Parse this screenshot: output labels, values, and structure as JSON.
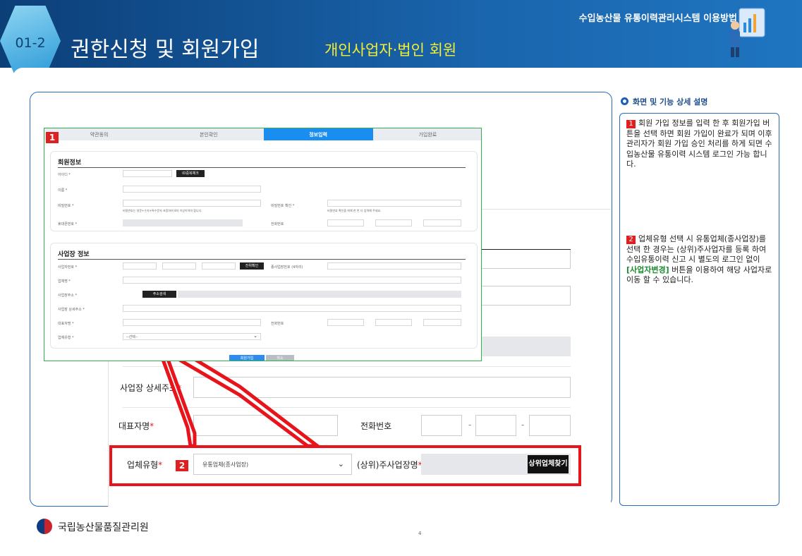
{
  "header": {
    "system_title": "수입농산물 유통이력관리시스템 이용방법",
    "section_no": "01-2",
    "title": "권한신청 및 회원가입",
    "subtitle": "개인사업자·법인 회원"
  },
  "panel": {
    "heading": "화면 및 기능 상세 설명",
    "notes": [
      {
        "num": "1",
        "text": "회원 가입 정보를 입력 한 후 회원가입 버튼을 선택 하면 회원 가입이 완료가 되며 이후 관리자가 회원 가입 승인 처리를 하게 되면 수입농산물 유통이력 시스템 로그인 가능 합니다."
      },
      {
        "num": "2",
        "text_before": "업체유형 선택 시 유통업체(종사업장)를 선택 한 경우는 (상위)주사업자를 등록 하여 수입유통이력 신고 시 별도의 로그인 없이 ",
        "highlight": "[사업자변경]",
        "text_after": " 버튼을 이용하여 해당 사업자로 이동 할 수 있습니다."
      }
    ]
  },
  "screenshot1": {
    "tag": "1",
    "steps": [
      "약관동의",
      "본인확인",
      "정보입력",
      "가입완료"
    ],
    "member_section": "회원정보",
    "member_fields": [
      "아이디 *",
      "이름 *",
      "비밀번호 *",
      "휴대폰번호 *"
    ],
    "id_check_btn": "ID중복체크",
    "pw_hint": "비밀번호는 영문+숫자+특수문자 포함하여 8자 이상이어야 합니다.",
    "pw_confirm_label": "비밀번호 확인 *",
    "pw_confirm_hint": "비밀번호 확인을 위해 한 번 더 입력해 주세요.",
    "phone_label": "전화번호",
    "biz_section": "사업장 정보",
    "biz_fields": [
      "사업자번호 *",
      "업체명 *",
      "사업장주소 *",
      "사업장 상세주소 *",
      "대표자명 *",
      "업체유형 *"
    ],
    "biz_confirm_btn": "진위확인",
    "sub_biz_label": "종사업장번호 (4자리)",
    "addr_search_btn": "주소검색",
    "biz_phone_label": "전화번호",
    "type_placeholder": "--선택--",
    "signup_btn": "회원가입",
    "cancel_btn": "취소"
  },
  "screenshot2": {
    "tag": "2",
    "detail_addr_label": "사업장 상세주소",
    "rep_label": "대표자명",
    "phone_label": "전화번호",
    "type_label": "업체유형",
    "type_value": "유통업체(종사업장)",
    "parent_label": "(상위)주사업장명",
    "find_btn": "상위업체찾기"
  },
  "footer": {
    "org": "국립농산물품질관리원",
    "page": "4"
  }
}
